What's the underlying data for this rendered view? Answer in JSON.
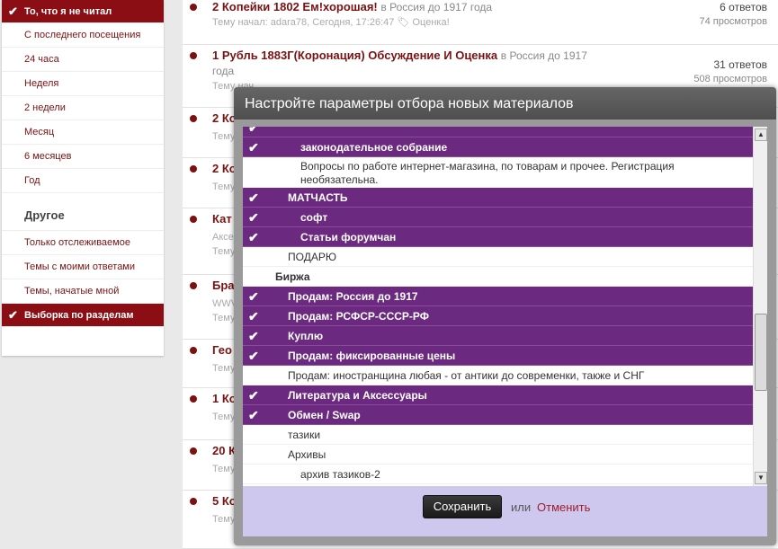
{
  "sidebar": {
    "items": [
      {
        "label": "То, что я не читал",
        "active": true
      },
      {
        "label": "С последнего посещения"
      },
      {
        "label": "24 часа"
      },
      {
        "label": "Неделя"
      },
      {
        "label": "2 недели"
      },
      {
        "label": "Месяц"
      },
      {
        "label": "6 месяцев"
      },
      {
        "label": "Год"
      }
    ],
    "other_heading": "Другое",
    "other_items": [
      {
        "label": "Только отслеживаемое"
      },
      {
        "label": "Темы с моими ответами"
      },
      {
        "label": "Темы, начатые мной"
      },
      {
        "label": "Выборка по разделам",
        "active": true
      }
    ]
  },
  "topics": [
    {
      "title": "2 Копейки 1802 Ем!хорошая!",
      "forum": "в Россия до 1917 года",
      "meta": "Тему начал: adara78, Сегодня, 17:26:47",
      "tag": "Оценка!",
      "replies": "6 ответов",
      "views": "74 просмотров"
    },
    {
      "title": "1 Рубль 1883Г(Коронация) Обсуждение И Оценка",
      "forum": "в Россия до 1917",
      "forum_cont": "года",
      "meta": "Тему нач",
      "replies": "31 ответов",
      "views": "508 просмотров"
    },
    {
      "title": "2 Ко",
      "meta": "Тему"
    },
    {
      "title": "2 Ко",
      "meta": "Тему"
    },
    {
      "title": "Кат",
      "meta": "Аксе",
      "meta2": "Тему"
    },
    {
      "title": "Бра",
      "meta": "WWV",
      "meta2": "Тему"
    },
    {
      "title": "Гео",
      "meta": "Тему"
    },
    {
      "title": "1 Ко",
      "meta": "Тему"
    },
    {
      "title": "20 К",
      "meta": "Тему"
    },
    {
      "title": "5 Ко",
      "meta": "Тему"
    }
  ],
  "modal": {
    "title": "Настройте параметры отбора новых материалов",
    "rows": [
      {
        "label": "законодательное собрание",
        "selected": true,
        "indent": 2
      },
      {
        "label": "Вопросы по работе интернет-магазина, по товарам и прочее. Регистрация необязательна.",
        "selected": false,
        "indent": 2,
        "multi": true
      },
      {
        "label": "МАТЧАСТЬ",
        "selected": true,
        "indent": 1
      },
      {
        "label": "софт",
        "selected": true,
        "indent": 2
      },
      {
        "label": "Статьи форумчан",
        "selected": true,
        "indent": 2
      },
      {
        "label": "ПОДАРЮ",
        "selected": false,
        "indent": 1
      },
      {
        "label": "Биржа",
        "selected": false,
        "indent": 0,
        "bold": true
      },
      {
        "label": "Продам: Россия до 1917",
        "selected": true,
        "indent": 1
      },
      {
        "label": "Продам: РСФСР-СССР-РФ",
        "selected": true,
        "indent": 1
      },
      {
        "label": "Куплю",
        "selected": true,
        "indent": 1
      },
      {
        "label": "Продам: фиксированные цены",
        "selected": true,
        "indent": 1
      },
      {
        "label": "Продам: иностранщина любая - от антики до современки, также и СНГ",
        "selected": false,
        "indent": 1
      },
      {
        "label": "Литература и Аксессуары",
        "selected": true,
        "indent": 1
      },
      {
        "label": "Обмен / Swap",
        "selected": true,
        "indent": 1
      },
      {
        "label": "тазики",
        "selected": false,
        "indent": 1
      },
      {
        "label": "Архивы",
        "selected": false,
        "indent": 1
      },
      {
        "label": "архив тазиков-2",
        "selected": false,
        "indent": 2
      }
    ],
    "save_label": "Сохранить",
    "or_text": "или",
    "cancel_label": "Отменить"
  },
  "colors": {
    "accent": "#8b0e14",
    "selected_row": "#6b2a7f",
    "footer_bg": "#cfc8ee"
  }
}
